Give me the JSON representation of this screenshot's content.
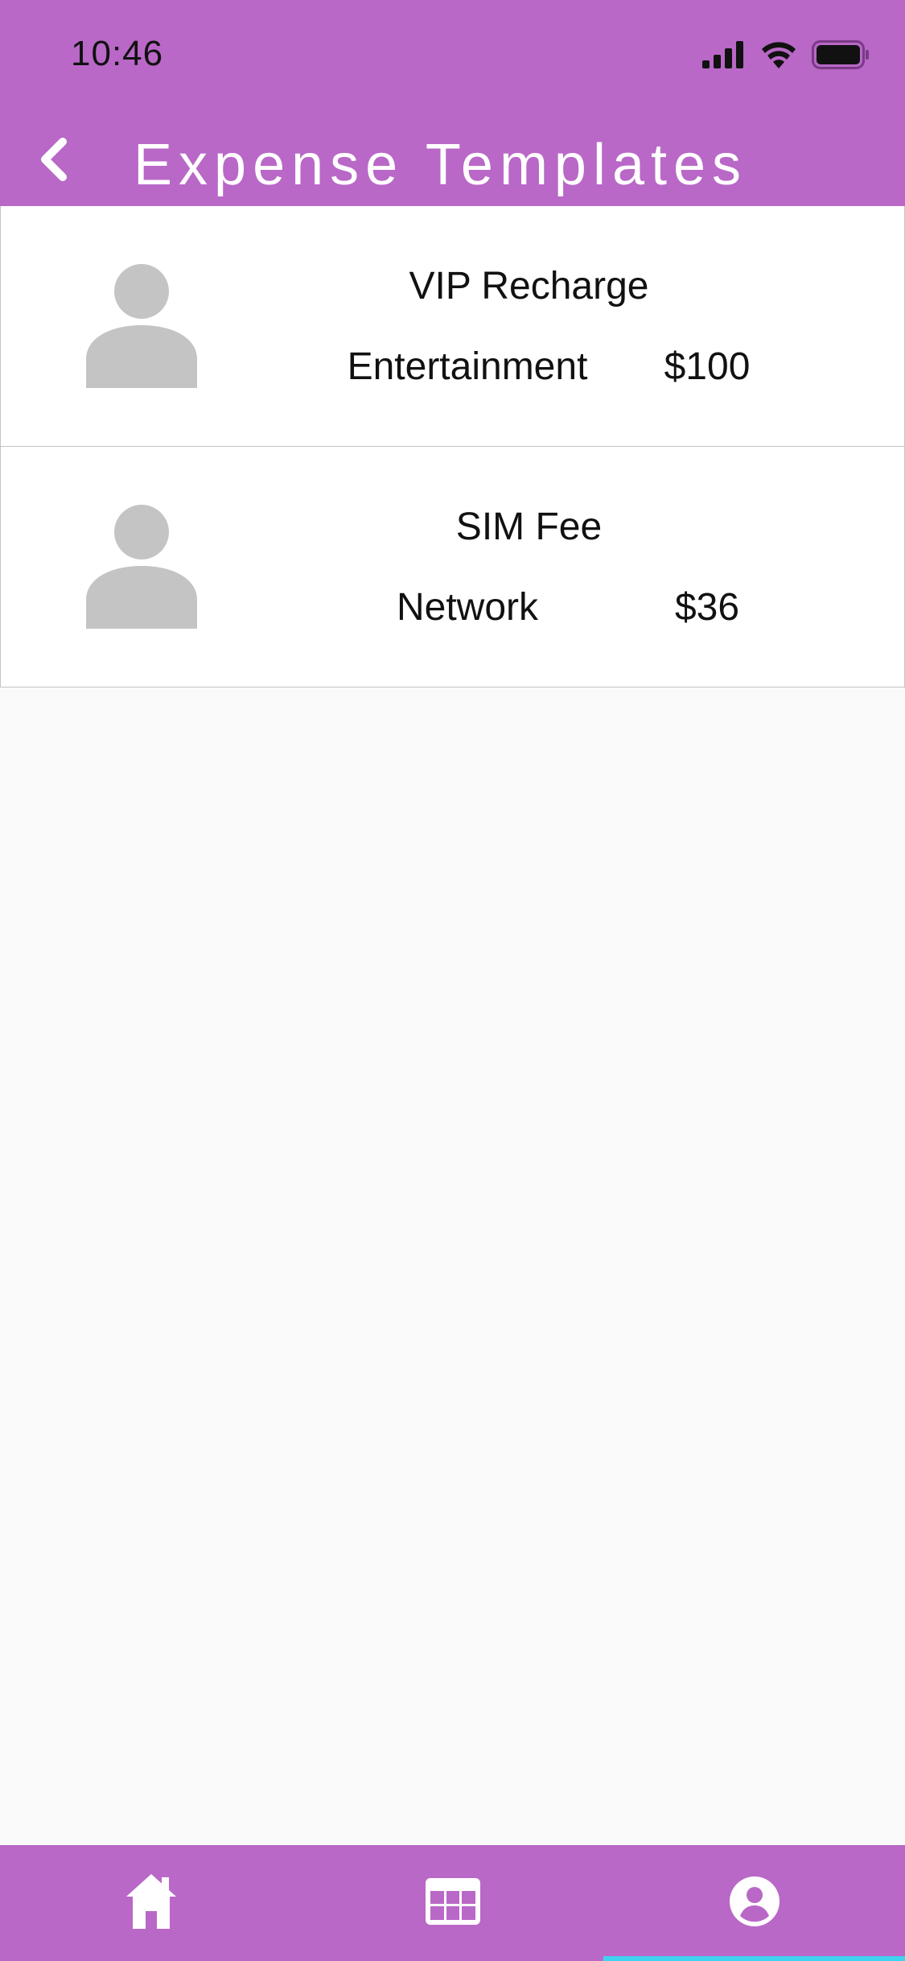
{
  "status_bar": {
    "time": "10:46"
  },
  "header": {
    "title": "Expense Templates",
    "back_icon": "chevron-left-icon"
  },
  "templates": [
    {
      "name": "VIP Recharge",
      "category": "Entertainment",
      "amount": "$100",
      "icon": "person-avatar-icon"
    },
    {
      "name": "SIM Fee",
      "category": "Network",
      "amount": "$36",
      "icon": "person-avatar-icon"
    }
  ],
  "bottom_nav": {
    "items": [
      {
        "icon": "home-icon"
      },
      {
        "icon": "calendar-table-icon"
      },
      {
        "icon": "account-circle-icon",
        "active": true
      }
    ]
  },
  "colors": {
    "primary": "#b968c7",
    "active_indicator": "#3fd2f0",
    "avatar_gray": "#c4c4c4"
  }
}
